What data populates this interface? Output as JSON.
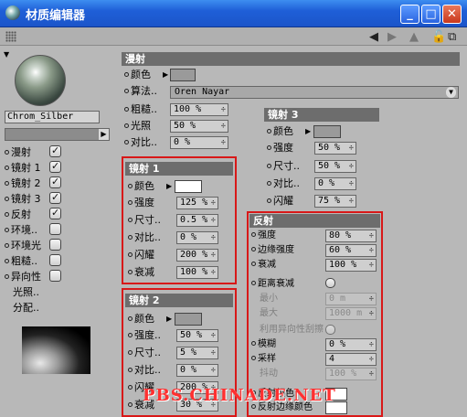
{
  "window": {
    "title": "材质编辑器",
    "min": "_",
    "max": "□",
    "close": "✕"
  },
  "toolbar": {
    "back": "◀",
    "forward": "▶",
    "up": "▲",
    "lock": "🔓",
    "newwin": "⧉"
  },
  "material": {
    "name": "Chrom_Silber"
  },
  "channels": [
    {
      "label": "漫射",
      "checked": true
    },
    {
      "label": "镜射 1",
      "checked": true
    },
    {
      "label": "镜射 2",
      "checked": true
    },
    {
      "label": "镜射 3",
      "checked": true
    },
    {
      "label": "反射",
      "checked": true
    },
    {
      "label": "环境..",
      "checked": false
    },
    {
      "label": "环境光",
      "checked": false
    },
    {
      "label": "粗糙..",
      "checked": false
    },
    {
      "label": "异向性",
      "checked": false
    },
    {
      "label": "光照..",
      "checked": null
    },
    {
      "label": "分配..",
      "checked": null
    }
  ],
  "diffuse": {
    "title": "漫射",
    "color_label": "颜色",
    "algo_label": "算法..",
    "algo_value": "Oren Nayar",
    "rough_label": "粗糙..",
    "rough_value": "100 %",
    "light_label": "光照",
    "light_value": "50 %",
    "contrast_label": "对比..",
    "contrast_value": "0 %"
  },
  "spec1": {
    "title": "镜射 1",
    "color": "颜色",
    "strength": "强度",
    "strength_v": "125 %",
    "size": "尺寸..",
    "size_v": "0.5 %",
    "contrast": "对比..",
    "contrast_v": "0 %",
    "glare": "闪耀",
    "glare_v": "200 %",
    "falloff": "衰减",
    "falloff_v": "100 %"
  },
  "spec2": {
    "title": "镜射 2",
    "color": "颜色",
    "strength": "强度..",
    "strength_v": "50 %",
    "size": "尺寸..",
    "size_v": "5 %",
    "contrast": "对比..",
    "contrast_v": "0 %",
    "glare": "闪耀",
    "glare_v": "200 %",
    "falloff": "衰减",
    "falloff_v": "30 %"
  },
  "spec3": {
    "title": "镜射 3",
    "color": "颜色",
    "strength": "强度",
    "strength_v": "50 %",
    "size": "尺寸..",
    "size_v": "50 %",
    "contrast": "对比..",
    "contrast_v": "0 %",
    "glare": "闪耀",
    "glare_v": "75 %"
  },
  "reflect": {
    "title": "反射",
    "strength": "强度",
    "strength_v": "80 %",
    "edge": "边缘强度",
    "edge_v": "60 %",
    "falloff": "衰减",
    "falloff_v": "100 %",
    "dist": "距离衰减",
    "min": "最小",
    "min_v": "0 m",
    "max": "最大",
    "max_v": "1000 m",
    "aniso": "利用异向性刮擦",
    "blur": "模糊",
    "blur_v": "0 %",
    "samples": "采样",
    "samples_v": "4",
    "jitter": "抖动",
    "jitter_v": "100 %",
    "color1": "反射颜色",
    "color2": "反射边缘颜色"
  },
  "watermark": "PBS.CHINADE.NET",
  "colors": {
    "accent_red": "#d81818",
    "title_blue": "#1f5fd8",
    "section_gray": "#6d6d6d"
  }
}
